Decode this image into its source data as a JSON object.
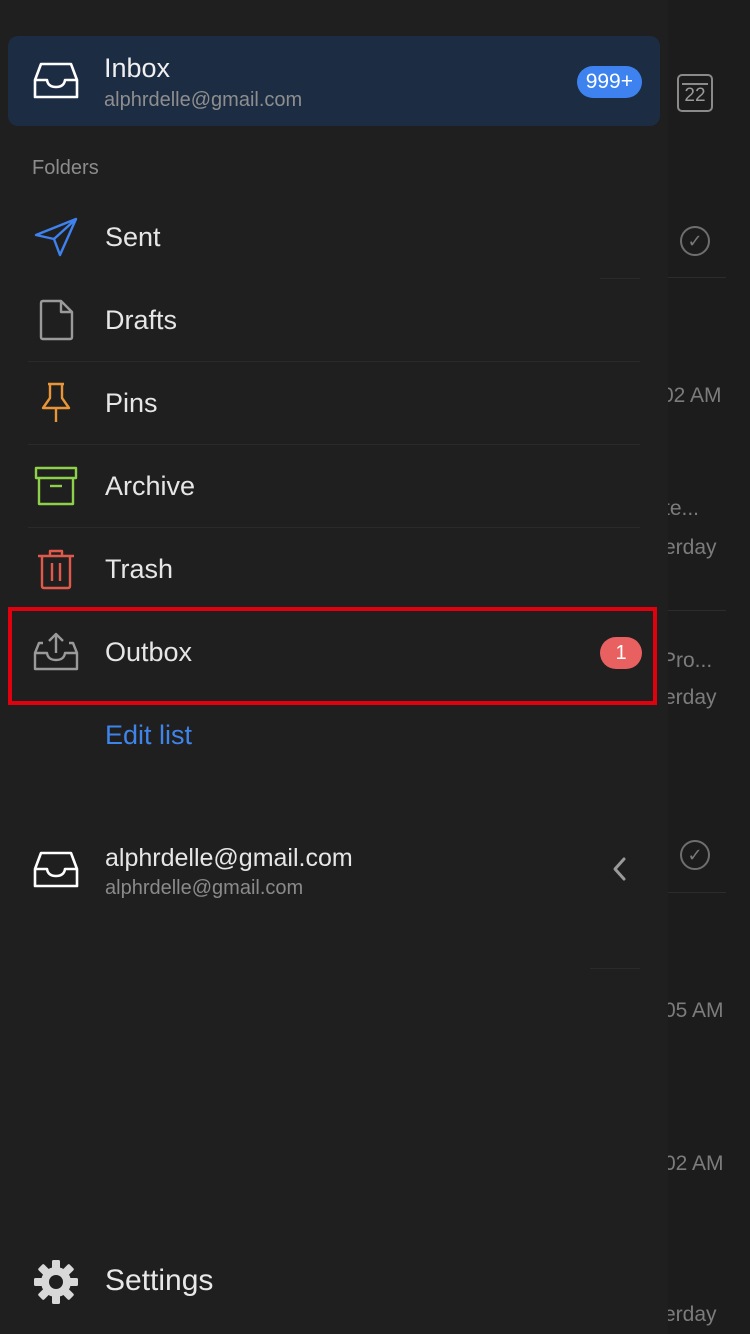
{
  "background": {
    "calendar_day": "22",
    "snippets": [
      {
        "text": "02 AM"
      },
      {
        "text": "te..."
      },
      {
        "text": "erday"
      },
      {
        "text": "Pro..."
      },
      {
        "text": "erday"
      },
      {
        "text": "05 AM"
      },
      {
        "text": "02 AM"
      },
      {
        "text": "erday"
      }
    ]
  },
  "inbox": {
    "title": "Inbox",
    "account": "alphrdelle@gmail.com",
    "badge": "999+",
    "icon": "inbox-tray-icon"
  },
  "folders_label": "Folders",
  "folders": [
    {
      "label": "Sent",
      "icon": "paper-plane-icon",
      "color": "#3e82f0"
    },
    {
      "label": "Drafts",
      "icon": "document-icon",
      "color": "#9a9a9a"
    },
    {
      "label": "Pins",
      "icon": "pushpin-icon",
      "color": "#e8953a"
    },
    {
      "label": "Archive",
      "icon": "archive-box-icon",
      "color": "#8ed04a"
    },
    {
      "label": "Trash",
      "icon": "trash-can-icon",
      "color": "#e0594a"
    },
    {
      "label": "Outbox",
      "icon": "outbox-upload-icon",
      "color": "#9a9a9a",
      "badge": "1",
      "highlighted": true
    }
  ],
  "edit_list": "Edit list",
  "account": {
    "title": "alphrdelle@gmail.com",
    "subtitle": "alphrdelle@gmail.com",
    "icon": "inbox-tray-icon"
  },
  "settings": {
    "label": "Settings",
    "icon": "gear-icon"
  },
  "colors": {
    "accent": "#3e82f0",
    "highlight_border": "#e0000e",
    "outbox_badge": "#e86060",
    "inbox_card": "#1c2c43"
  }
}
